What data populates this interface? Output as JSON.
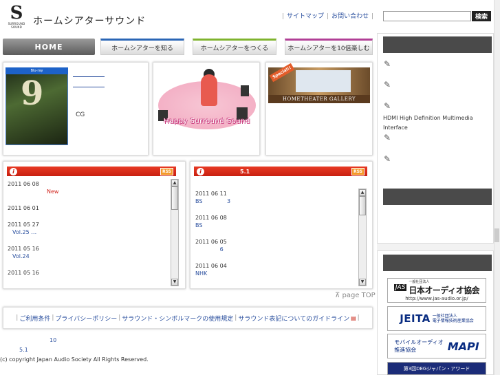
{
  "header": {
    "logo_letter": "S",
    "logo_sub": "SURROUND SOUND",
    "site_title": "ホームシアターサウンド",
    "toplinks": [
      "サイトマップ",
      "お問い合わせ"
    ],
    "search_button": "検索",
    "search_value": ""
  },
  "nav": {
    "home": "HOME",
    "items": [
      "ホームシアターを知る",
      "ホームシアターをつくる",
      "ホームシアターを10倍楽しむ"
    ]
  },
  "features": {
    "bd_num": "9",
    "cg_label": "CG",
    "happy_text": "Happy Surround Sound",
    "gallery_label": "HOMETHEATER GALLERY",
    "special": "Special!!"
  },
  "news1": {
    "title": "",
    "rss": "RSS",
    "items": [
      {
        "date": "2011 06 08",
        "text": "",
        "badge": "New"
      },
      {
        "date": "2011 06 01",
        "text": "",
        "badge": ""
      },
      {
        "date": "2011 05 27",
        "text": "Vol.25    …",
        "badge": ""
      },
      {
        "date": "2011 05 16",
        "text": "Vol.24",
        "badge": ""
      },
      {
        "date": "2011 05 16",
        "text": "",
        "badge": ""
      }
    ]
  },
  "news2": {
    "title": "5.1",
    "rss": "RSS",
    "items": [
      {
        "date": "2011 06 11",
        "text": "BS              3"
      },
      {
        "date": "2011 06 08",
        "text": "BS"
      },
      {
        "date": "2011 06 05",
        "text": "              6"
      },
      {
        "date": "2011 06 04",
        "text": "NHK"
      }
    ]
  },
  "pagetop": "page TOP",
  "footer": {
    "links": [
      "ご利用条件",
      "プライバシーポリシー",
      "サラウンド・シンボルマークの使用規定",
      "サラウンド表記についてのガイドライン"
    ],
    "line_a": "10",
    "line_b": "5.1",
    "copyright": "(c) copyright Japan Audio Society All Rights Reserved."
  },
  "sidebar": {
    "items": [
      "",
      "",
      "",
      "HDMI High Definition Multimedia Interface",
      "",
      ""
    ],
    "banners": {
      "jas_mark": "JAS",
      "jas_small": "一般社団法人",
      "jas_name": "日本オーディオ協会",
      "jas_url": "http://www.jas-audio.or.jp/",
      "jeita": "JEITA",
      "jeita_sub1": "一般社団法人",
      "jeita_sub2": "電子情報技術産業協会",
      "mapi_t1": "モバイルオーディオ",
      "mapi_t2": "推進協会",
      "mapi": "MAPI",
      "deg": "第3回DEGジャパン・アワード"
    }
  }
}
